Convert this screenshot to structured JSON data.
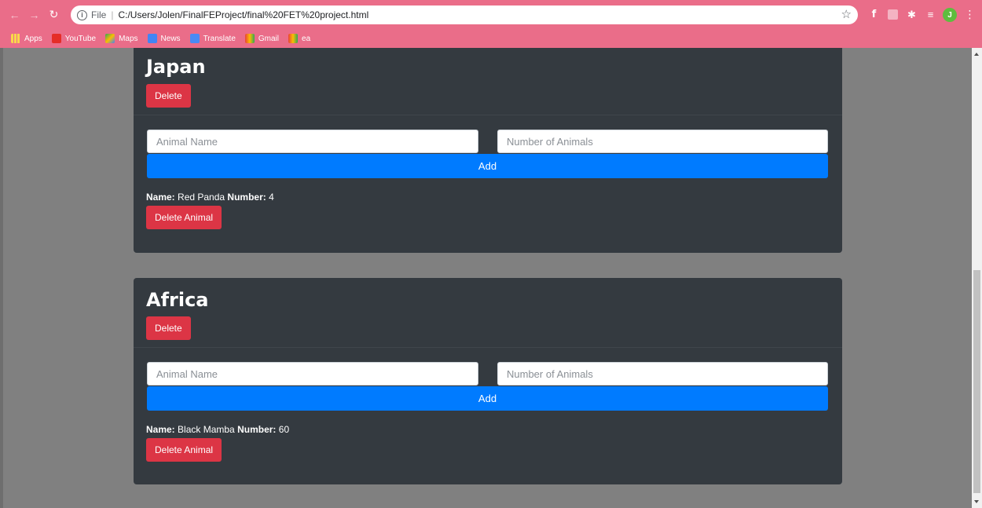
{
  "browser": {
    "scheme_label": "File",
    "url": "C:/Users/Jolen/FinalFEProject/final%20FET%20project.html",
    "avatar_letter": "J",
    "bookmarks": [
      {
        "label": "Apps"
      },
      {
        "label": "YouTube"
      },
      {
        "label": "Maps"
      },
      {
        "label": "News"
      },
      {
        "label": "Translate"
      },
      {
        "label": "Gmail"
      },
      {
        "label": "ea"
      }
    ]
  },
  "habitats": [
    {
      "name": "Japan",
      "delete_label": "Delete",
      "animal_name_placeholder": "Animal Name",
      "animal_number_placeholder": "Number of Animals",
      "add_label": "Add",
      "animals": [
        {
          "name_label": "Name:",
          "name": "Red Panda",
          "number_label": "Number:",
          "number": "4",
          "delete_label": "Delete Animal"
        }
      ]
    },
    {
      "name": "Africa",
      "delete_label": "Delete",
      "animal_name_placeholder": "Animal Name",
      "animal_number_placeholder": "Number of Animals",
      "add_label": "Add",
      "animals": [
        {
          "name_label": "Name:",
          "name": "Black Mamba",
          "number_label": "Number:",
          "number": "60",
          "delete_label": "Delete Animal"
        }
      ]
    }
  ],
  "colors": {
    "browser_chrome": "#ea6d89",
    "card": "#343a40",
    "danger": "#dc3545",
    "primary": "#007bff",
    "page_bg": "#808080"
  }
}
